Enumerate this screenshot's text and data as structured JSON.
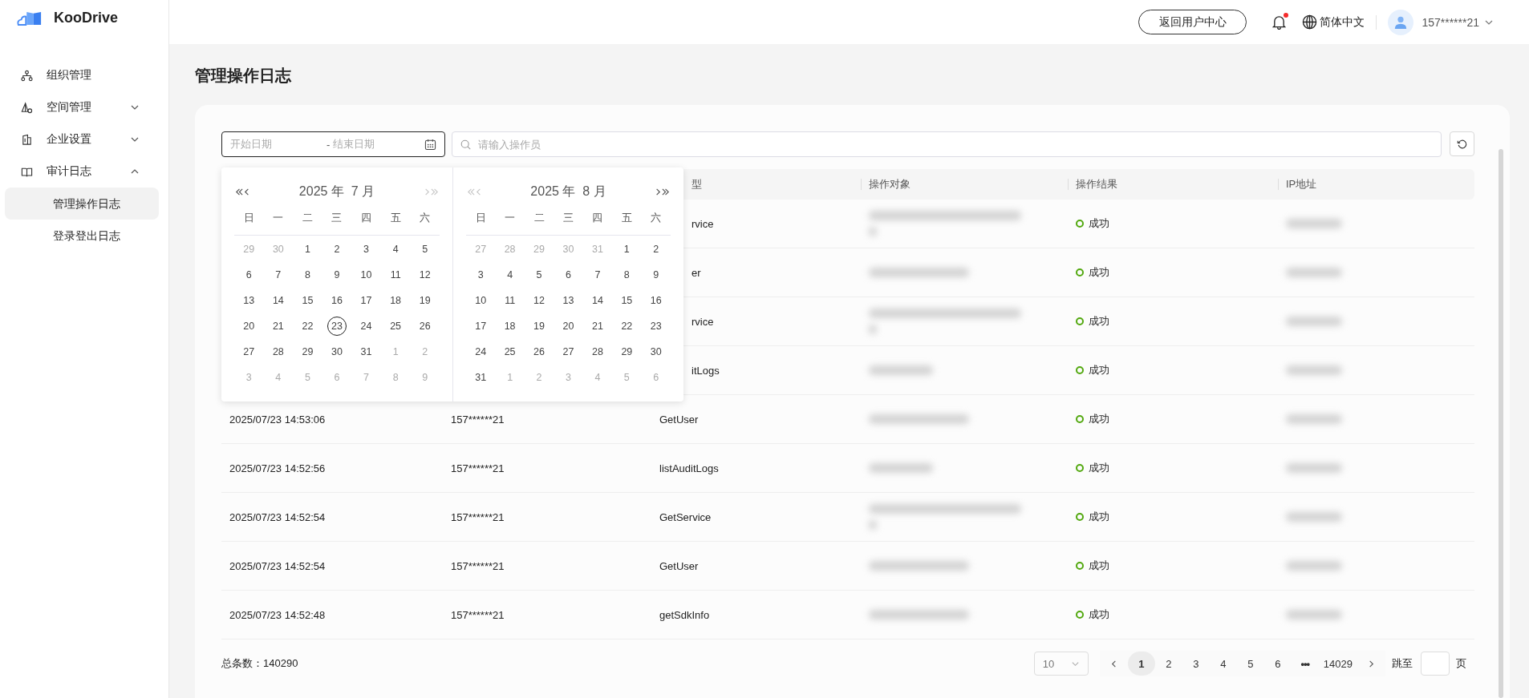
{
  "brand": {
    "name": "KooDrive"
  },
  "topbar": {
    "back_button": "返回用户中心",
    "unread": true,
    "language": "简体中文",
    "user": "157******21"
  },
  "sidebar": {
    "items": [
      {
        "label": "组织管理",
        "kind": "link"
      },
      {
        "label": "空间管理",
        "kind": "group",
        "expanded": false
      },
      {
        "label": "企业设置",
        "kind": "group",
        "expanded": false
      },
      {
        "label": "审计日志",
        "kind": "group",
        "expanded": true,
        "children": [
          {
            "label": "管理操作日志",
            "selected": true
          },
          {
            "label": "登录登出日志",
            "selected": false
          }
        ]
      }
    ]
  },
  "page_title": "管理操作日志",
  "filters": {
    "date_range": {
      "start_placeholder": "开始日期",
      "separator": "-",
      "end_placeholder": "结束日期",
      "focused": true
    },
    "search": {
      "placeholder": "请输入操作员"
    }
  },
  "calendar": {
    "panels": [
      {
        "title": "2025 年  7 月",
        "prev_enabled": true,
        "next_enabled": false,
        "weekdays": [
          "日",
          "一",
          "二",
          "三",
          "四",
          "五",
          "六"
        ],
        "days": [
          {
            "day": "29",
            "kind": "other"
          },
          {
            "day": "30",
            "kind": "other"
          },
          {
            "day": "1",
            "kind": "day"
          },
          {
            "day": "2",
            "kind": "day"
          },
          {
            "day": "3",
            "kind": "day"
          },
          {
            "day": "4",
            "kind": "day"
          },
          {
            "day": "5",
            "kind": "day"
          },
          {
            "day": "6",
            "kind": "day"
          },
          {
            "day": "7",
            "kind": "day"
          },
          {
            "day": "8",
            "kind": "day"
          },
          {
            "day": "9",
            "kind": "day"
          },
          {
            "day": "10",
            "kind": "day"
          },
          {
            "day": "11",
            "kind": "day"
          },
          {
            "day": "12",
            "kind": "day"
          },
          {
            "day": "13",
            "kind": "day"
          },
          {
            "day": "14",
            "kind": "day"
          },
          {
            "day": "15",
            "kind": "day"
          },
          {
            "day": "16",
            "kind": "day"
          },
          {
            "day": "17",
            "kind": "day"
          },
          {
            "day": "18",
            "kind": "day"
          },
          {
            "day": "19",
            "kind": "day"
          },
          {
            "day": "20",
            "kind": "day"
          },
          {
            "day": "21",
            "kind": "day"
          },
          {
            "day": "22",
            "kind": "day"
          },
          {
            "day": "23",
            "kind": "today"
          },
          {
            "day": "24",
            "kind": "day"
          },
          {
            "day": "25",
            "kind": "day"
          },
          {
            "day": "26",
            "kind": "day"
          },
          {
            "day": "27",
            "kind": "day"
          },
          {
            "day": "28",
            "kind": "day"
          },
          {
            "day": "29",
            "kind": "day"
          },
          {
            "day": "30",
            "kind": "day"
          },
          {
            "day": "31",
            "kind": "day"
          },
          {
            "day": "1",
            "kind": "other"
          },
          {
            "day": "2",
            "kind": "other"
          },
          {
            "day": "3",
            "kind": "other"
          },
          {
            "day": "4",
            "kind": "other"
          },
          {
            "day": "5",
            "kind": "other"
          },
          {
            "day": "6",
            "kind": "other"
          },
          {
            "day": "7",
            "kind": "other"
          },
          {
            "day": "8",
            "kind": "other"
          },
          {
            "day": "9",
            "kind": "other"
          }
        ]
      },
      {
        "title": "2025 年  8 月",
        "prev_enabled": false,
        "next_enabled": true,
        "weekdays": [
          "日",
          "一",
          "二",
          "三",
          "四",
          "五",
          "六"
        ],
        "days": [
          {
            "day": "27",
            "kind": "other"
          },
          {
            "day": "28",
            "kind": "other"
          },
          {
            "day": "29",
            "kind": "other"
          },
          {
            "day": "30",
            "kind": "other"
          },
          {
            "day": "31",
            "kind": "other"
          },
          {
            "day": "1",
            "kind": "day"
          },
          {
            "day": "2",
            "kind": "day"
          },
          {
            "day": "3",
            "kind": "day"
          },
          {
            "day": "4",
            "kind": "day"
          },
          {
            "day": "5",
            "kind": "day"
          },
          {
            "day": "6",
            "kind": "day"
          },
          {
            "day": "7",
            "kind": "day"
          },
          {
            "day": "8",
            "kind": "day"
          },
          {
            "day": "9",
            "kind": "day"
          },
          {
            "day": "10",
            "kind": "day"
          },
          {
            "day": "11",
            "kind": "day"
          },
          {
            "day": "12",
            "kind": "day"
          },
          {
            "day": "13",
            "kind": "day"
          },
          {
            "day": "14",
            "kind": "day"
          },
          {
            "day": "15",
            "kind": "day"
          },
          {
            "day": "16",
            "kind": "day"
          },
          {
            "day": "17",
            "kind": "day"
          },
          {
            "day": "18",
            "kind": "day"
          },
          {
            "day": "19",
            "kind": "day"
          },
          {
            "day": "20",
            "kind": "day"
          },
          {
            "day": "21",
            "kind": "day"
          },
          {
            "day": "22",
            "kind": "day"
          },
          {
            "day": "23",
            "kind": "day"
          },
          {
            "day": "24",
            "kind": "day"
          },
          {
            "day": "25",
            "kind": "day"
          },
          {
            "day": "26",
            "kind": "day"
          },
          {
            "day": "27",
            "kind": "day"
          },
          {
            "day": "28",
            "kind": "day"
          },
          {
            "day": "29",
            "kind": "day"
          },
          {
            "day": "30",
            "kind": "day"
          },
          {
            "day": "31",
            "kind": "day"
          },
          {
            "day": "1",
            "kind": "other"
          },
          {
            "day": "2",
            "kind": "other"
          },
          {
            "day": "3",
            "kind": "other"
          },
          {
            "day": "4",
            "kind": "other"
          },
          {
            "day": "5",
            "kind": "other"
          },
          {
            "day": "6",
            "kind": "other"
          }
        ]
      }
    ]
  },
  "table": {
    "columns": [
      "型",
      "操作对象",
      "操作结果",
      "IP地址"
    ],
    "rows": [
      {
        "type": "rvice",
        "result": "成功"
      },
      {
        "type": "er",
        "result": "成功"
      },
      {
        "type": "rvice",
        "result": "成功"
      },
      {
        "type": "itLogs",
        "result": "成功"
      },
      {
        "time": "2025/07/23 14:53:06",
        "operator": "157******21",
        "type": "GetUser",
        "result": "成功"
      },
      {
        "time": "2025/07/23 14:52:56",
        "operator": "157******21",
        "type": "listAuditLogs",
        "result": "成功"
      },
      {
        "time": "2025/07/23 14:52:54",
        "operator": "157******21",
        "type": "GetService",
        "result": "成功"
      },
      {
        "time": "2025/07/23 14:52:54",
        "operator": "157******21",
        "type": "GetUser",
        "result": "成功"
      },
      {
        "time": "2025/07/23 14:52:48",
        "operator": "157******21",
        "type": "getSdkInfo",
        "result": "成功"
      }
    ]
  },
  "pagination": {
    "total": "总条数：140290",
    "page_size": "10",
    "pages": [
      {
        "label": "1",
        "kind": "page",
        "selected": true
      },
      {
        "label": "2",
        "kind": "page",
        "selected": false
      },
      {
        "label": "3",
        "kind": "page",
        "selected": false
      },
      {
        "label": "4",
        "kind": "page",
        "selected": false
      },
      {
        "label": "5",
        "kind": "page",
        "selected": false
      },
      {
        "label": "6",
        "kind": "page",
        "selected": false
      },
      {
        "label": "•••",
        "kind": "ellipsis",
        "selected": false
      },
      {
        "label": "14029",
        "kind": "page",
        "selected": false
      }
    ],
    "jump_label": "跳至",
    "page_suffix": "页"
  }
}
